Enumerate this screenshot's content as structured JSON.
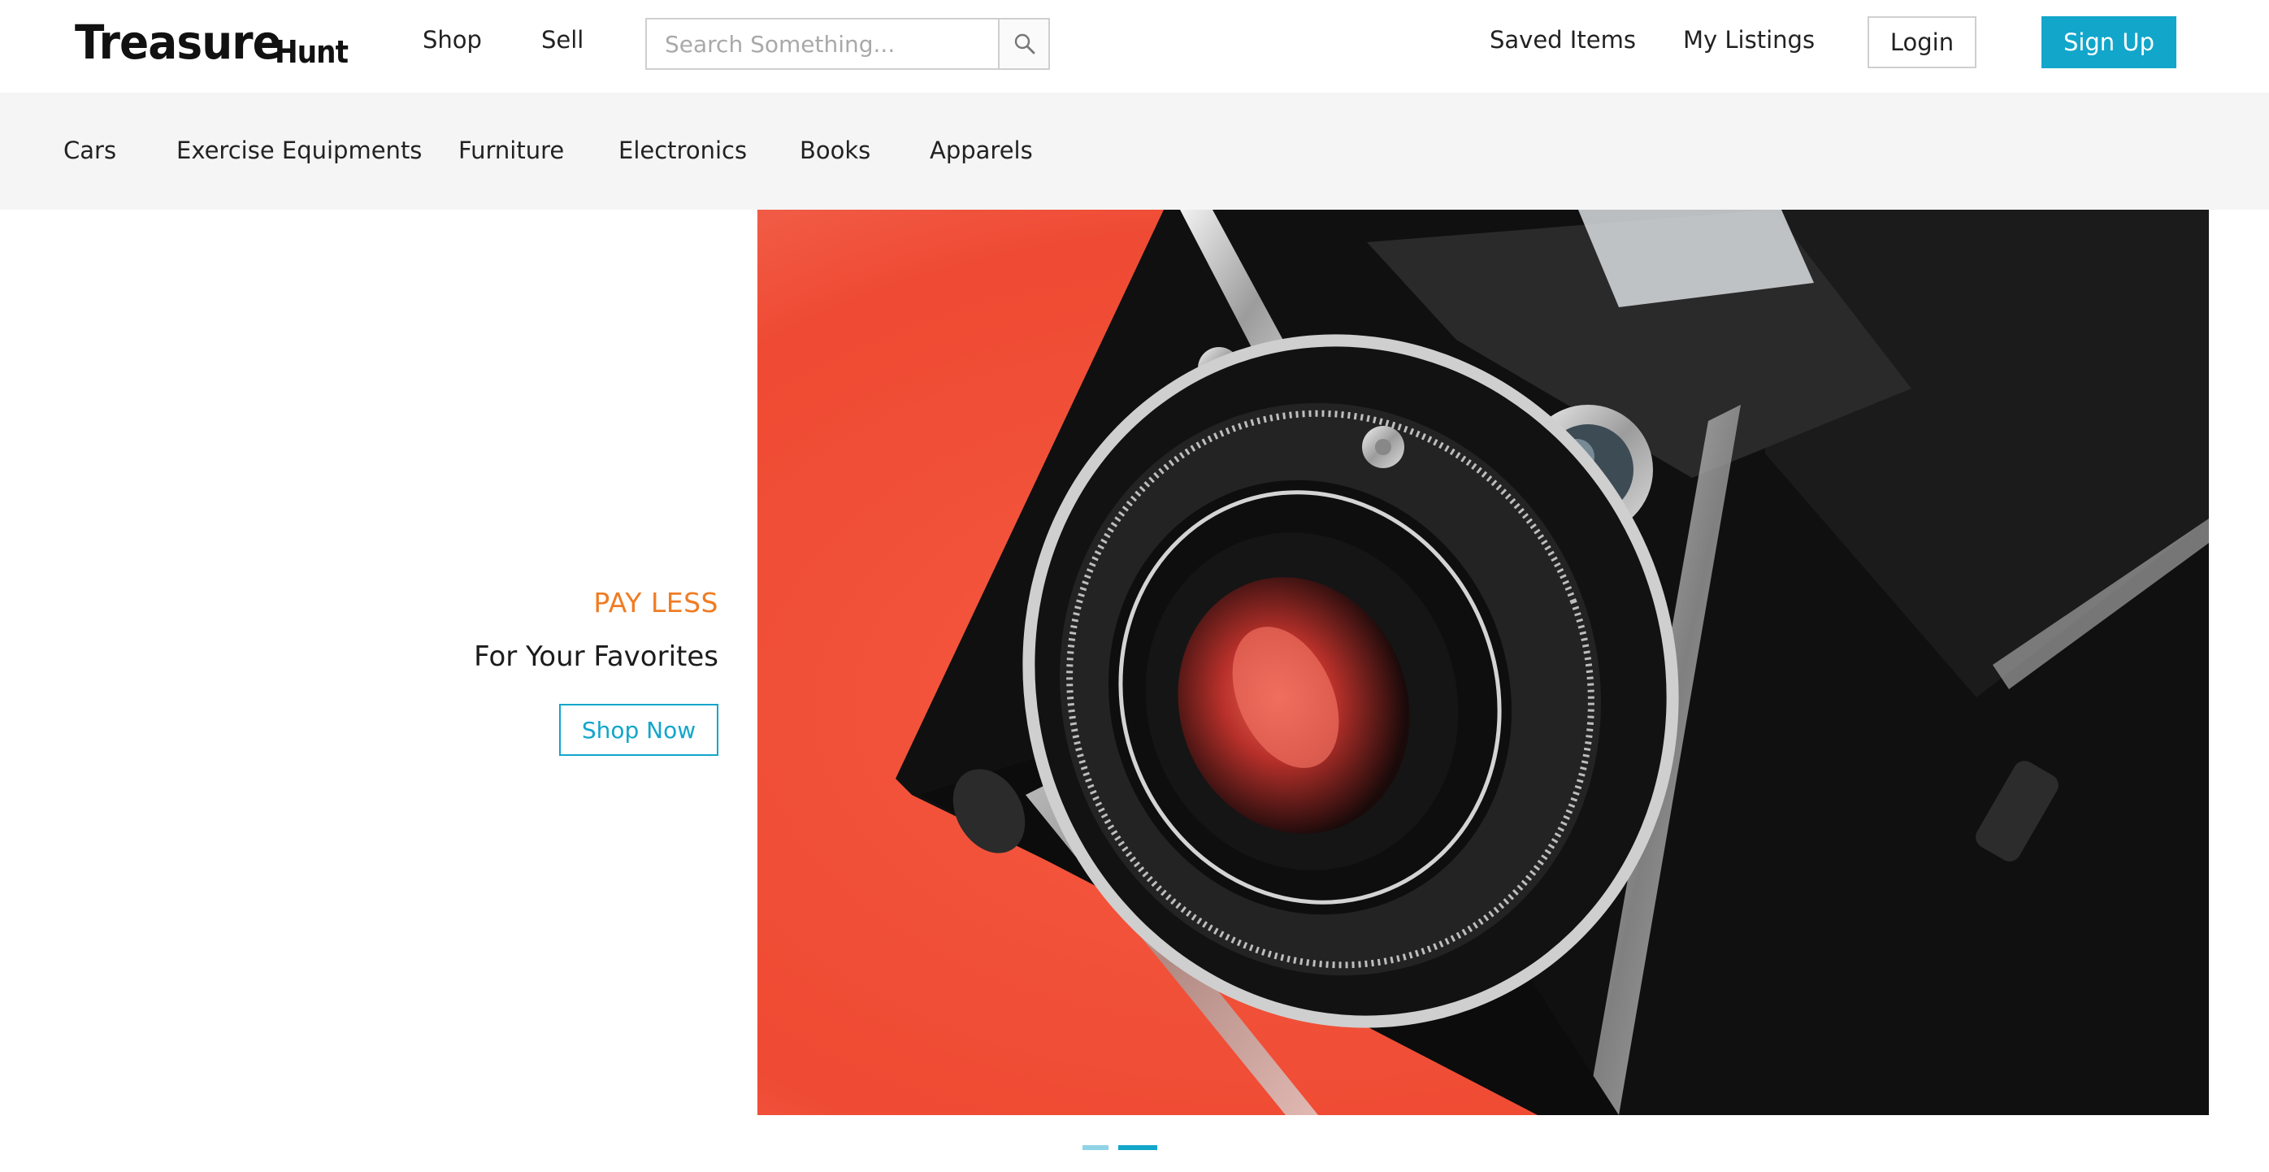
{
  "brand": {
    "logo_main": "Treasure",
    "logo_sub": "Hunt"
  },
  "header": {
    "nav": [
      {
        "label": "Shop"
      },
      {
        "label": "Sell"
      }
    ],
    "search": {
      "placeholder": "Search Something...",
      "value": "",
      "icon": "search-icon"
    },
    "right_links": [
      {
        "label": "Saved Items"
      },
      {
        "label": "My Listings"
      }
    ],
    "login_label": "Login",
    "signup_label": "Sign Up"
  },
  "categories": [
    {
      "label": "Cars"
    },
    {
      "label": "Exercise Equipments"
    },
    {
      "label": "Furniture"
    },
    {
      "label": "Electronics"
    },
    {
      "label": "Books"
    },
    {
      "label": "Apparels"
    }
  ],
  "hero": {
    "tagline": "PAY LESS",
    "subtitle": "For Your Favorites",
    "cta_label": "Shop Now",
    "image": "vintage-folding-camera-on-red-background",
    "slides_total": 2,
    "active_slide": 2
  },
  "colors": {
    "accent": "#12a6cb",
    "tagline": "#f07c24",
    "category_bar": "#f5f5f5",
    "hero_background": "#f04a33"
  }
}
